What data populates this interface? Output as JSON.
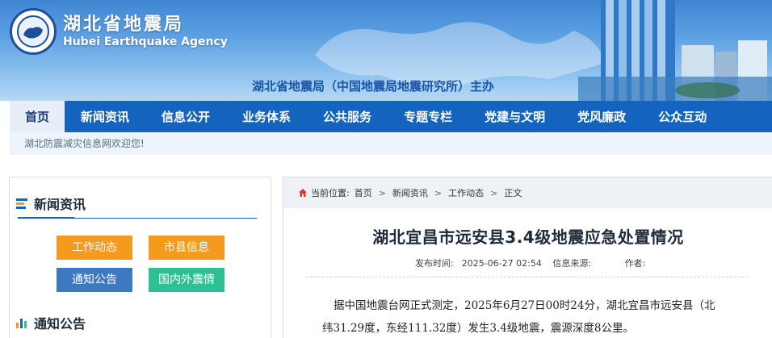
{
  "header": {
    "site_name_cn": "湖北省地震局",
    "site_name_en": "Hubei Earthquake Agency",
    "sponsor": "湖北省地震局（中国地震局地震研究所）主办",
    "logo_icon": "agency-seal-icon"
  },
  "nav": {
    "items": [
      {
        "label": "首页",
        "active": true
      },
      {
        "label": "新闻资讯"
      },
      {
        "label": "信息公开"
      },
      {
        "label": "业务体系"
      },
      {
        "label": "公共服务"
      },
      {
        "label": "专题专栏"
      },
      {
        "label": "党建与文明"
      },
      {
        "label": "党风廉政"
      },
      {
        "label": "公众互动"
      }
    ],
    "active_bg": "#e7eef8",
    "bar_color": "#1463be"
  },
  "welcome": "湖北防震减灾信息网欢迎您!",
  "sidebar": {
    "section_title": "新闻资讯",
    "buttons": [
      {
        "label": "工作动态",
        "color": "#f49a1f"
      },
      {
        "label": "市县信息",
        "color": "#f49a1f"
      },
      {
        "label": "通知公告",
        "color": "#3d79c0"
      },
      {
        "label": "国内外震情",
        "color": "#2fbf95"
      }
    ],
    "section2_title": "通知公告"
  },
  "breadcrumb": {
    "prefix": "当前位置:",
    "items": [
      "首页",
      "新闻资讯",
      "工作动态",
      "正文"
    ],
    "separator": ">"
  },
  "article": {
    "title": "湖北宜昌市远安县3.4级地震应急处置情况",
    "publish_time_label": "发布时间:",
    "publish_time": "2025-06-27 02:54",
    "source_label": "信息来源:",
    "source": "",
    "author_label": "作者:",
    "author": "",
    "paragraph_line1": "据中国地震台网正式测定，2025年6月27日00时24分，湖北宜昌市远安县（北",
    "paragraph_line2": "纬31.29度，东经111.32度）发生3.4级地震，震源深度8公里。"
  }
}
